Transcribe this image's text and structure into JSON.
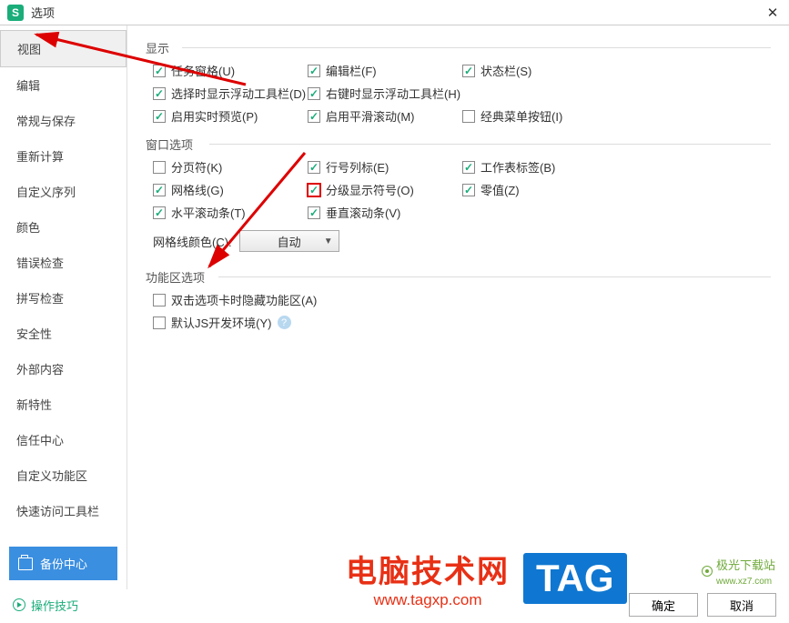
{
  "titlebar": {
    "icon": "S",
    "title": "选项"
  },
  "sidebar": {
    "items": [
      {
        "label": "视图",
        "active": true
      },
      {
        "label": "编辑"
      },
      {
        "label": "常规与保存"
      },
      {
        "label": "重新计算"
      },
      {
        "label": "自定义序列"
      },
      {
        "label": "颜色"
      },
      {
        "label": "错误检查"
      },
      {
        "label": "拼写检查"
      },
      {
        "label": "安全性"
      },
      {
        "label": "外部内容"
      },
      {
        "label": "新特性"
      },
      {
        "label": "信任中心"
      },
      {
        "label": "自定义功能区"
      },
      {
        "label": "快速访问工具栏"
      }
    ],
    "backup": "备份中心"
  },
  "groups": {
    "display": {
      "label": "显示",
      "rows": [
        [
          {
            "label": "任务窗格(U)",
            "checked": true
          },
          {
            "label": "编辑栏(F)",
            "checked": true
          },
          {
            "label": "状态栏(S)",
            "checked": true
          }
        ],
        [
          {
            "label": "选择时显示浮动工具栏(D)",
            "checked": true
          },
          {
            "label": "右键时显示浮动工具栏(H)",
            "checked": true
          }
        ],
        [
          {
            "label": "启用实时预览(P)",
            "checked": true
          },
          {
            "label": "启用平滑滚动(M)",
            "checked": true
          },
          {
            "label": "经典菜单按钮(I)",
            "checked": false
          }
        ]
      ]
    },
    "window": {
      "label": "窗口选项",
      "rows": [
        [
          {
            "label": "分页符(K)",
            "checked": false
          },
          {
            "label": "行号列标(E)",
            "checked": true
          },
          {
            "label": "工作表标签(B)",
            "checked": true
          }
        ],
        [
          {
            "label": "网格线(G)",
            "checked": true
          },
          {
            "label": "分级显示符号(O)",
            "checked": true,
            "hl": true
          },
          {
            "label": "零值(Z)",
            "checked": true
          }
        ],
        [
          {
            "label": "水平滚动条(T)",
            "checked": true
          },
          {
            "label": "垂直滚动条(V)",
            "checked": true
          }
        ]
      ],
      "gridcolor": {
        "label": "网格线颜色(C):",
        "value": "自动"
      }
    },
    "ribbon": {
      "label": "功能区选项",
      "items": [
        {
          "label": "双击选项卡时隐藏功能区(A)",
          "checked": false
        },
        {
          "label": "默认JS开发环境(Y)",
          "checked": false,
          "help": true
        }
      ]
    }
  },
  "footer": {
    "tips": "操作技巧",
    "ok": "确定",
    "cancel": "取消"
  },
  "watermark": {
    "text1": "电脑技术网",
    "url": "www.tagxp.com",
    "tag": "TAG",
    "site": "极光下载站",
    "siteurl": "www.xz7.com"
  }
}
